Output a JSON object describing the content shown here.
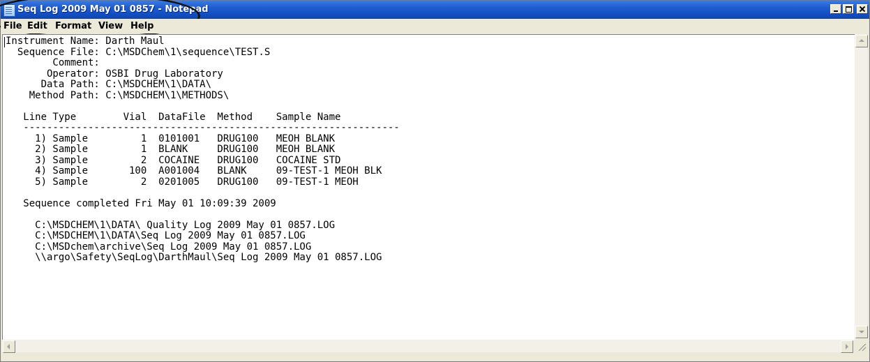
{
  "window": {
    "title": "Seq Log 2009 May 01 0857 - Notepad",
    "icon": "notepad-icon"
  },
  "menu": {
    "file": "File",
    "edit": "Edit",
    "format": "Format",
    "view": "View",
    "help": "Help"
  },
  "document": {
    "text": "Instrument Name: Darth Maul\n  Sequence File: C:\\MSDChem\\1\\sequence\\TEST.S\n        Comment:\n       Operator: OSBI Drug Laboratory\n      Data Path: C:\\MSDCHEM\\1\\DATA\\\n    Method Path: C:\\MSDCHEM\\1\\METHODS\\\n\n   Line Type        Vial  DataFile  Method    Sample Name\n   ----------------------------------------------------------------\n     1) Sample         1  0101001   DRUG100   MEOH BLANK\n     2) Sample         1  BLANK     DRUG100   MEOH BLANK\n     3) Sample         2  COCAINE   DRUG100   COCAINE STD\n     4) Sample       100  A001004   BLANK     09-TEST-1 MEOH BLK\n     5) Sample         2  0201005   DRUG100   09-TEST-1 MEOH\n\n   Sequence completed Fri May 01 10:09:39 2009\n\n     C:\\MSDCHEM\\1\\DATA\\ Quality Log 2009 May 01 0857.LOG\n     C:\\MSDCHEM\\1\\DATA\\Seq Log 2009 May 01 0857.LOG\n     C:\\MSDchem\\archive\\Seq Log 2009 May 01 0857.LOG\n     \\\\argo\\Safety\\SeqLog\\DarthMaul\\Seq Log 2009 May 01 0857.LOG"
  }
}
